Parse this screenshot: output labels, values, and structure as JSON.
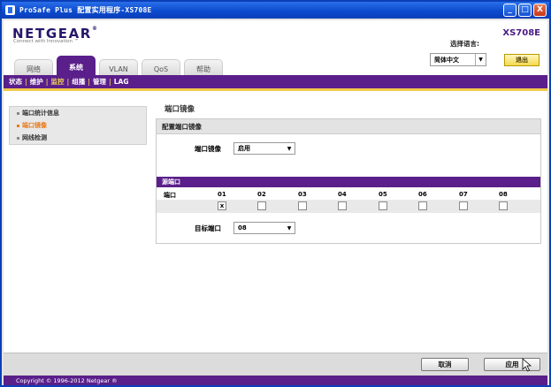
{
  "window": {
    "title": "ProSafe Plus 配置实用程序-XS708E",
    "controls": {
      "minimize": "_",
      "maximize": "□",
      "close": "X"
    }
  },
  "header": {
    "logo": "NETGEAR",
    "logo_mark": "®",
    "tagline": "Connect with Innovation ™",
    "model": "XS708E",
    "language_label": "选择语言:",
    "language_value": "简体中文",
    "logout_label": "退出"
  },
  "tabs": [
    {
      "label": "网络",
      "active": false
    },
    {
      "label": "系统",
      "active": true
    },
    {
      "label": "VLAN",
      "active": false
    },
    {
      "label": "QoS",
      "active": false
    },
    {
      "label": "帮助",
      "active": false
    }
  ],
  "subnav": [
    {
      "label": "状态",
      "active": false
    },
    {
      "label": "维护",
      "active": false
    },
    {
      "label": "监控",
      "active": true
    },
    {
      "label": "组播",
      "active": false
    },
    {
      "label": "管理",
      "active": false
    },
    {
      "label": "LAG",
      "active": false
    }
  ],
  "sidebar": {
    "items": [
      {
        "label": "端口统计信息",
        "active": false
      },
      {
        "label": "端口镜像",
        "active": true
      },
      {
        "label": "网线检测",
        "active": false
      }
    ]
  },
  "panel": {
    "title": "端口镜像",
    "section_title": "配置端口镜像",
    "mirror_label": "端口镜像",
    "mirror_value": "启用",
    "source_title": "源端口",
    "port_header": "端口",
    "ports": [
      "01",
      "02",
      "03",
      "04",
      "05",
      "06",
      "07",
      "08"
    ],
    "checked": [
      "x",
      "",
      "",
      "",
      "",
      "",
      "",
      ""
    ],
    "dest_label": "目标端口",
    "dest_value": "08"
  },
  "footer": {
    "cancel_label": "取消",
    "apply_label": "应用",
    "copyright": "Copyright © 1996-2012 Netgear ®"
  },
  "colors": {
    "brand_purple": "#5a1f8a",
    "accent_gold": "#f2c94a",
    "active_orange": "#e87a18",
    "titlebar_blue": "#0c4bcf"
  }
}
